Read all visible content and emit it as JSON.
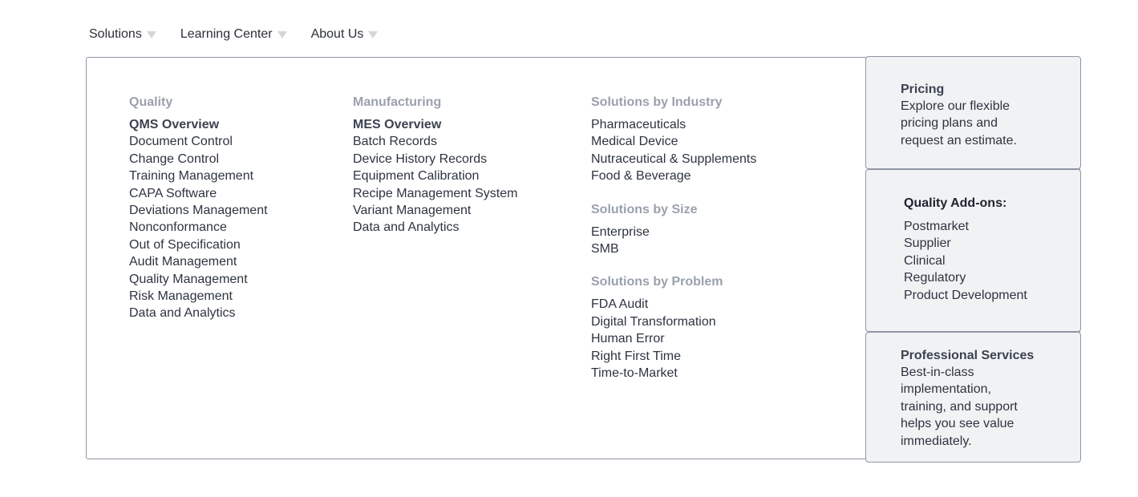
{
  "nav": {
    "items": [
      {
        "label": "Solutions"
      },
      {
        "label": "Learning Center"
      },
      {
        "label": "About Us"
      }
    ]
  },
  "columns": {
    "quality": {
      "title": "Quality",
      "links": [
        "QMS Overview",
        "Document Control",
        "Change Control",
        "Training Management",
        "CAPA Software",
        "Deviations Management",
        "Nonconformance",
        "Out of Specification",
        "Audit Management",
        "Quality Management",
        "Risk Management",
        "Data and Analytics"
      ]
    },
    "manufacturing": {
      "title": "Manufacturing",
      "links": [
        "MES Overview",
        "Batch Records",
        "Device History Records",
        "Equipment Calibration",
        "Recipe Management System",
        "Variant Management",
        "Data and Analytics"
      ]
    },
    "industry": {
      "title": "Solutions by Industry",
      "links": [
        "Pharmaceuticals",
        "Medical Device",
        "Nutraceutical & Supplements",
        "Food & Beverage"
      ]
    },
    "size": {
      "title": "Solutions by Size",
      "links": [
        "Enterprise",
        "SMB"
      ]
    },
    "problem": {
      "title": "Solutions by Problem",
      "links": [
        "FDA Audit",
        "Digital Transformation",
        "Human Error",
        "Right First Time",
        "Time-to-Market"
      ]
    }
  },
  "cards": {
    "pricing": {
      "title": "Pricing",
      "desc": [
        "Explore our flexible",
        "pricing plans and",
        "request an estimate."
      ]
    },
    "addons": {
      "title": "Quality Add-ons:",
      "links": [
        "Postmarket",
        "Supplier",
        "Clinical",
        "Regulatory",
        "Product Development"
      ]
    },
    "services": {
      "title": "Professional Services",
      "desc": [
        "Best-in-class",
        "implementation,",
        "training, and support",
        "helps you see value",
        "immediately."
      ]
    }
  }
}
